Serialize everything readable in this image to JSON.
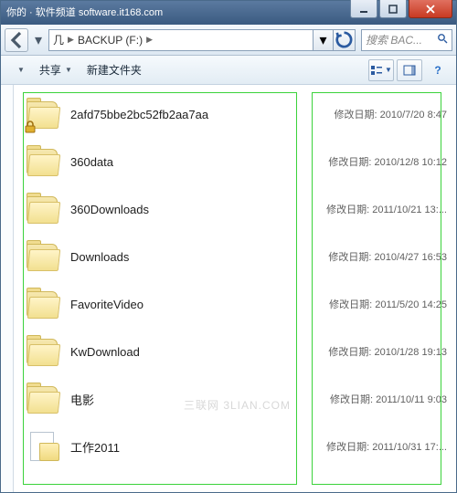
{
  "title_overlay": "你的 · 软件频道  software.it168.com",
  "titlebar_caption": "",
  "breadcrumb": {
    "root_label": "几",
    "drive_label": "BACKUP (F:)"
  },
  "search_placeholder": "搜索 BAC...",
  "toolbar": {
    "share": "共享",
    "newfolder": "新建文件夹"
  },
  "meta_label": "修改日期:",
  "watermark": "三联网 3LIAN.COM",
  "items": [
    {
      "name": "2afd75bbe2bc52fb2aa7aa",
      "date": "2010/7/20 8:47",
      "type": "folder",
      "locked": true
    },
    {
      "name": "360data",
      "date": "2010/12/8 10:12",
      "type": "folder",
      "locked": false
    },
    {
      "name": "360Downloads",
      "date": "2011/10/21 13:...",
      "type": "folder",
      "locked": false
    },
    {
      "name": "Downloads",
      "date": "2010/4/27 16:53",
      "type": "folder",
      "locked": false
    },
    {
      "name": "FavoriteVideo",
      "date": "2011/5/20 14:25",
      "type": "folder",
      "locked": false
    },
    {
      "name": "KwDownload",
      "date": "2010/1/28 19:13",
      "type": "folder",
      "locked": false
    },
    {
      "name": "电影",
      "date": "2011/10/11 9:03",
      "type": "folder",
      "locked": false
    },
    {
      "name": "工作2011",
      "date": "2011/10/31 17:...",
      "type": "filefolder",
      "locked": false
    }
  ]
}
